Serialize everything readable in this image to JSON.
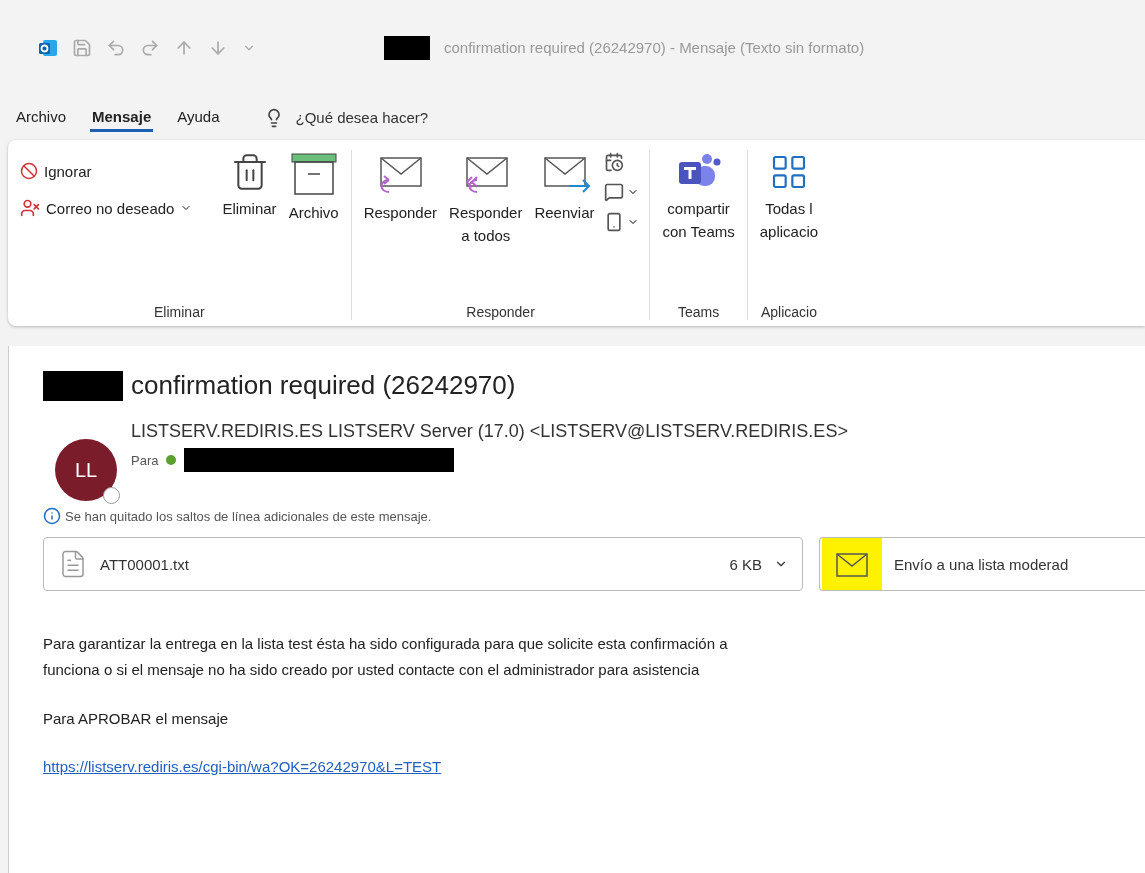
{
  "title_bar": {
    "title": "confirmation required (26242970)  -  Mensaje (Texto sin formato)",
    "redacted": true
  },
  "menu_tabs": [
    {
      "label": "Archivo",
      "selected": false
    },
    {
      "label": "Mensaje",
      "selected": true
    },
    {
      "label": "Ayuda",
      "selected": false
    }
  ],
  "search": {
    "placeholder": "¿Qué desea hacer?"
  },
  "ribbon": {
    "groups": [
      {
        "label": "Eliminar",
        "items": [
          {
            "kind": "small",
            "label": "Ignorar"
          },
          {
            "kind": "small",
            "label": "Correo no deseado",
            "dropdown": true
          },
          {
            "kind": "large",
            "label": "Eliminar"
          },
          {
            "kind": "large",
            "label": "Archivo"
          }
        ]
      },
      {
        "label": "Responder",
        "items": [
          {
            "kind": "large",
            "label": "Responder"
          },
          {
            "kind": "large",
            "label": "Responder a todos"
          },
          {
            "kind": "large",
            "label": "Reenviar"
          },
          {
            "kind": "iconstack"
          }
        ]
      },
      {
        "label": "Teams",
        "items": [
          {
            "kind": "large",
            "label": "compartir con Teams"
          }
        ]
      },
      {
        "label": "Aplicacio",
        "items": [
          {
            "kind": "large",
            "label": "Todas l aplicacio"
          }
        ]
      }
    ]
  },
  "message": {
    "subject": "confirmation required (26242970)",
    "subject_redacted": true,
    "avatar": {
      "initials": "LL",
      "color": "#7b1c2a"
    },
    "sender": "LISTSERV.REDIRIS.ES LISTSERV Server (17.0) <LISTSERV@LISTSERV.REDIRIS.ES>",
    "to_label": "Para",
    "info": "Se han quitado los saltos de línea adicionales de este mensaje.",
    "attachments": [
      {
        "kind": "file",
        "name": "ATT00001.txt",
        "size": "6 KB",
        "highlighted": false
      },
      {
        "kind": "message",
        "name": "Envío a una lista moderad",
        "highlighted": true
      }
    ],
    "body": [
      {
        "kind": "text",
        "lines": [
          "Para garantizar la entrega  en la lista test ésta ha  sido configurada para que solicite esta confirmación a",
          "funciona o si el mensaje  no ha sido creado  por usted contacte con  el administrador para asistencia"
        ]
      },
      {
        "kind": "text",
        "lines": [
          "Para APROBAR el mensaje"
        ]
      },
      {
        "kind": "link",
        "lines": [
          "https://listserv.rediris.es/cgi-bin/wa?OK=26242970&L=TEST"
        ]
      }
    ]
  }
}
